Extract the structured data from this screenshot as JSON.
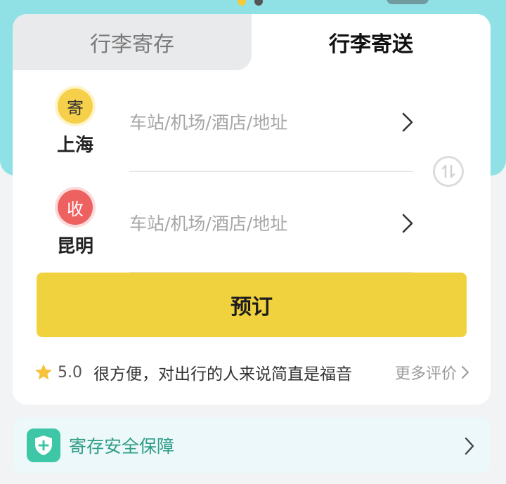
{
  "tabs": {
    "storage": "行李寄存",
    "delivery": "行李寄送"
  },
  "sender": {
    "badge": "寄",
    "city": "上海",
    "address_placeholder": "车站/机场/酒店/地址"
  },
  "receiver": {
    "badge": "收",
    "city": "昆明",
    "address_placeholder": "车站/机场/酒店/地址"
  },
  "book_button": "预订",
  "review": {
    "rating": "5.0",
    "text": "很方便，对出行的人来说简直是福音",
    "more": "更多评价"
  },
  "safety": {
    "label": "寄存安全保障"
  },
  "colors": {
    "accent_yellow": "#f0d23f",
    "hero_cyan": "#8fe1e6",
    "send_badge": "#f6d04a",
    "receive_badge": "#ee6161",
    "safety_green": "#3ec7a6"
  },
  "icons": {
    "swap": "swap-icon",
    "star": "star-icon",
    "shield": "shield-plus-icon",
    "chevron": "chevron-right-icon"
  }
}
